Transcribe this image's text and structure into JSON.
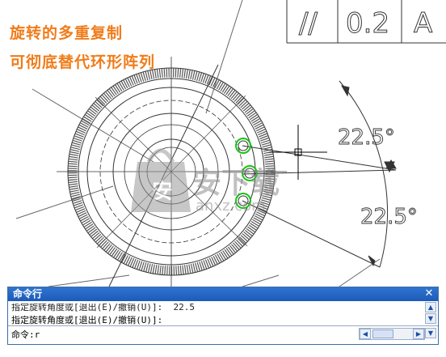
{
  "captions": {
    "line1": "旋转的多重复制",
    "line2": "可彻底替代环形阵列"
  },
  "drawing": {
    "title_block_values": [
      "//",
      "0.2",
      "A"
    ],
    "angle_labels": [
      "22.5°",
      "22.5°"
    ]
  },
  "watermark": {
    "brand_cn": "安下载",
    "brand_en": "anxz.com"
  },
  "command_window": {
    "title": "命令行",
    "close_symbol": "✕",
    "history": [
      "指定旋转角度或[退出(E)/撤销(U)]:  22.5",
      "指定旋转角度或[退出(E)/撤销(U)]:"
    ],
    "prompt": "命令:r"
  },
  "colors": {
    "caption": "#f07c1a",
    "title_bar": "#2f74d0",
    "selection_circle": "#19c419",
    "drawing_lines": "#333333"
  }
}
